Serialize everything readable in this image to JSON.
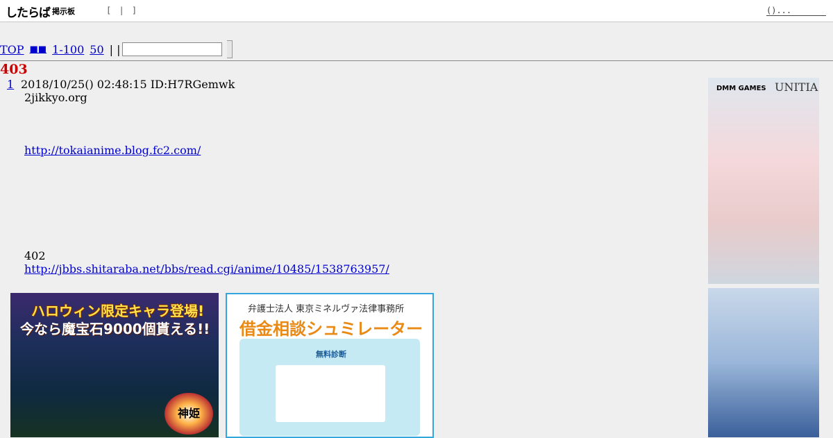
{
  "header": {
    "logo": "したらば",
    "logo_sub": "掲示板",
    "top_links": "[ | ]",
    "right_link": "()..."
  },
  "nav": {
    "top": "TOP",
    "board": "■■",
    "range1": "1-100",
    "range2": "50",
    "separators": "| |",
    "search_value": ""
  },
  "thread": {
    "title": "403",
    "post": {
      "number": "1",
      "meta": "2018/10/25() 02:48:15 ID:H7RGemwk",
      "line1": "2jikkyo.org",
      "link1": "http://tokaianime.blog.fc2.com/",
      "line2": "402",
      "link2": "http://jbbs.shitaraba.net/bbs/read.cgi/anime/10485/1538763957/"
    }
  },
  "ads": {
    "ad1_line1": "ハロウィン限定キャラ登場!",
    "ad1_line2": "今なら魔宝石9000個貰える!!",
    "ad1_logo": "神姫",
    "ad2_firm": "弁護士法人 東京ミネルヴァ法律事務所",
    "ad2_title": "借金相談シュミレーター",
    "ad2_badge": "無料診断",
    "side_brand": "DMM GAMES",
    "side_brand2": "UNITIA"
  }
}
